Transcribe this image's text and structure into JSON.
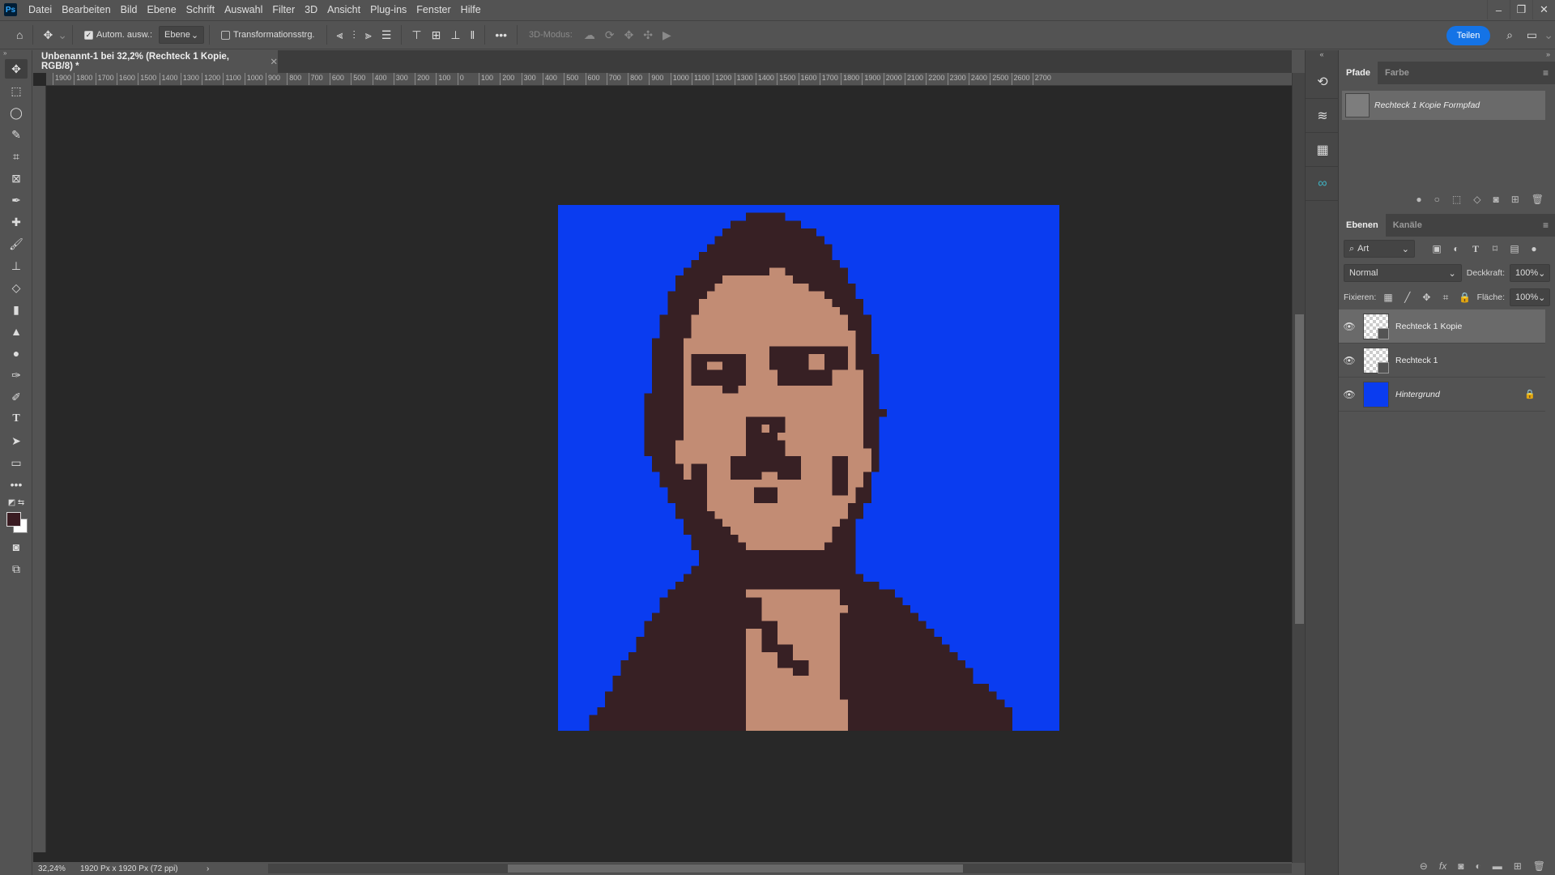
{
  "app": {
    "logo": "Ps"
  },
  "menu": [
    "Datei",
    "Bearbeiten",
    "Bild",
    "Ebene",
    "Schrift",
    "Auswahl",
    "Filter",
    "3D",
    "Ansicht",
    "Plug-ins",
    "Fenster",
    "Hilfe"
  ],
  "window_controls": {
    "minimize": "–",
    "restore": "❐",
    "close": "✕"
  },
  "options": {
    "auto_select_label": "Autom. ausw.:",
    "auto_select_checked": true,
    "auto_select_target": "Ebene",
    "transform_label": "Transformationsstrg.",
    "transform_checked": false,
    "mode3d_label": "3D-Modus:",
    "more": "•••",
    "share": "Teilen"
  },
  "document": {
    "tab_title": "Unbenannt-1 bei 32,2% (Rechteck 1 Kopie, RGB/8) *",
    "ruler_labels": [
      "1900",
      "1800",
      "1700",
      "1600",
      "1500",
      "1400",
      "1300",
      "1200",
      "1100",
      "1000",
      "900",
      "800",
      "700",
      "600",
      "500",
      "400",
      "300",
      "200",
      "100",
      "0",
      "100",
      "200",
      "300",
      "400",
      "500",
      "600",
      "700",
      "800",
      "900",
      "1000",
      "1100",
      "1200",
      "1300",
      "1400",
      "1500",
      "1600",
      "1700",
      "1800",
      "1900",
      "2000",
      "2100",
      "2200",
      "2300",
      "2400",
      "2500",
      "2600",
      "2700"
    ],
    "zoom": "32,24%",
    "dimensions": "1920 Px x 1920 Px (72 ppi)",
    "colors": {
      "background": "#0a3cf0",
      "dark": "#372024",
      "skin": "#c28c74"
    }
  },
  "tools": [
    "move",
    "marquee",
    "lasso",
    "quick-select",
    "crop",
    "frame",
    "eyedropper",
    "healing",
    "brush",
    "stamp",
    "eraser",
    "gradient",
    "sharpen",
    "dodge",
    "pen",
    "curvature-pen",
    "type",
    "path-select",
    "rectangle",
    "more",
    "swap-colors",
    "foreground-background",
    "quick-mask",
    "screen-mode"
  ],
  "colors": {
    "foreground": "#3a1c22",
    "background": "#ffffff"
  },
  "paths_panel": {
    "tabs": [
      "Pfade",
      "Farbe"
    ],
    "items": [
      {
        "name": "Rechteck 1 Kopie Formpfad"
      }
    ]
  },
  "layers_panel": {
    "tabs": [
      "Ebenen",
      "Kanäle"
    ],
    "filter": "Art",
    "blend_mode": "Normal",
    "opacity_label": "Deckkraft:",
    "opacity": "100%",
    "lock_label": "Fixieren:",
    "fill_label": "Fläche:",
    "fill": "100%",
    "layers": [
      {
        "name": "Rechteck 1 Kopie",
        "visible": true,
        "selected": true,
        "type": "shape"
      },
      {
        "name": "Rechteck 1",
        "visible": true,
        "selected": false,
        "type": "shape"
      },
      {
        "name": "Hintergrund",
        "visible": true,
        "selected": false,
        "type": "background",
        "locked": true
      }
    ]
  }
}
